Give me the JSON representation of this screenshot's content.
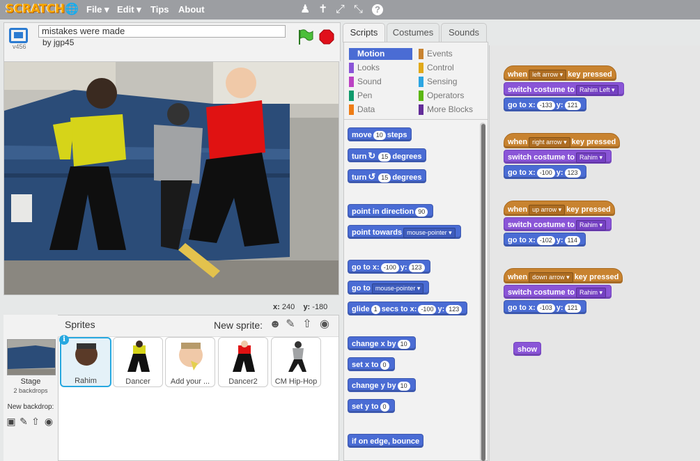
{
  "menubar": {
    "logo": "SCRATCH",
    "items": [
      "File ▾",
      "Edit ▾",
      "Tips",
      "About"
    ]
  },
  "project": {
    "title": "mistakes were made",
    "author": "by jgp45",
    "version": "v456"
  },
  "stage_coords": {
    "x_label": "x:",
    "x": "240",
    "y_label": "y:",
    "y": "-180"
  },
  "tabs": [
    "Scripts",
    "Costumes",
    "Sounds"
  ],
  "categories": {
    "left": [
      {
        "label": "Motion",
        "color": "#4a6cd4"
      },
      {
        "label": "Looks",
        "color": "#8a55d7"
      },
      {
        "label": "Sound",
        "color": "#bb42c3"
      },
      {
        "label": "Pen",
        "color": "#0e9a6c"
      },
      {
        "label": "Data",
        "color": "#ee7d16"
      }
    ],
    "right": [
      {
        "label": "Events",
        "color": "#c88330"
      },
      {
        "label": "Control",
        "color": "#e1a91a"
      },
      {
        "label": "Sensing",
        "color": "#2ca5e2"
      },
      {
        "label": "Operators",
        "color": "#5cb712"
      },
      {
        "label": "More Blocks",
        "color": "#632d99"
      }
    ]
  },
  "palette": {
    "move": {
      "a": "move",
      "n": "10",
      "b": "steps"
    },
    "turn_cw": {
      "a": "turn",
      "n": "15",
      "b": "degrees"
    },
    "turn_ccw": {
      "a": "turn",
      "n": "15",
      "b": "degrees"
    },
    "point_dir": {
      "a": "point in direction",
      "n": "90"
    },
    "point_towards": {
      "a": "point towards",
      "d": "mouse-pointer"
    },
    "goto_xy": {
      "a": "go to x:",
      "x": "-100",
      "b": "y:",
      "y": "123"
    },
    "goto": {
      "a": "go to",
      "d": "mouse-pointer"
    },
    "glide": {
      "a": "glide",
      "n": "1",
      "b": "secs to x:",
      "x": "-100",
      "c": "y:",
      "y": "123"
    },
    "change_x": {
      "a": "change x by",
      "n": "10"
    },
    "set_x": {
      "a": "set x to",
      "n": "0"
    },
    "change_y": {
      "a": "change y by",
      "n": "10"
    },
    "set_y": {
      "a": "set y to",
      "n": "0"
    },
    "bounce": {
      "a": "if on edge, bounce"
    }
  },
  "scripts": [
    {
      "when": "when",
      "key": "left arrow",
      "pressed": "key pressed",
      "switch": "switch costume to",
      "costume": "Rahim Left",
      "goto": "go to x:",
      "x": "-133",
      "ylab": "y:",
      "y": "121"
    },
    {
      "when": "when",
      "key": "right arrow",
      "pressed": "key pressed",
      "switch": "switch costume to",
      "costume": "Rahim",
      "goto": "go to x:",
      "x": "-100",
      "ylab": "y:",
      "y": "123"
    },
    {
      "when": "when",
      "key": "up arrow",
      "pressed": "key pressed",
      "switch": "switch costume to",
      "costume": "Rahim",
      "goto": "go to x:",
      "x": "-102",
      "ylab": "y:",
      "y": "114"
    },
    {
      "when": "when",
      "key": "down arrow",
      "pressed": "key pressed",
      "switch": "switch costume to",
      "costume": "Rahim",
      "goto": "go to x:",
      "x": "-103",
      "ylab": "y:",
      "y": "121"
    }
  ],
  "show_block": "show",
  "sprites_pane": {
    "label": "Sprites",
    "new_sprite": "New sprite:",
    "stage_name": "Stage",
    "stage_sub": "2 backdrops",
    "new_backdrop": "New backdrop:",
    "sprites": [
      "Rahim",
      "Dancer",
      "Add your ...",
      "Dancer2",
      "CM Hip-Hop"
    ]
  }
}
